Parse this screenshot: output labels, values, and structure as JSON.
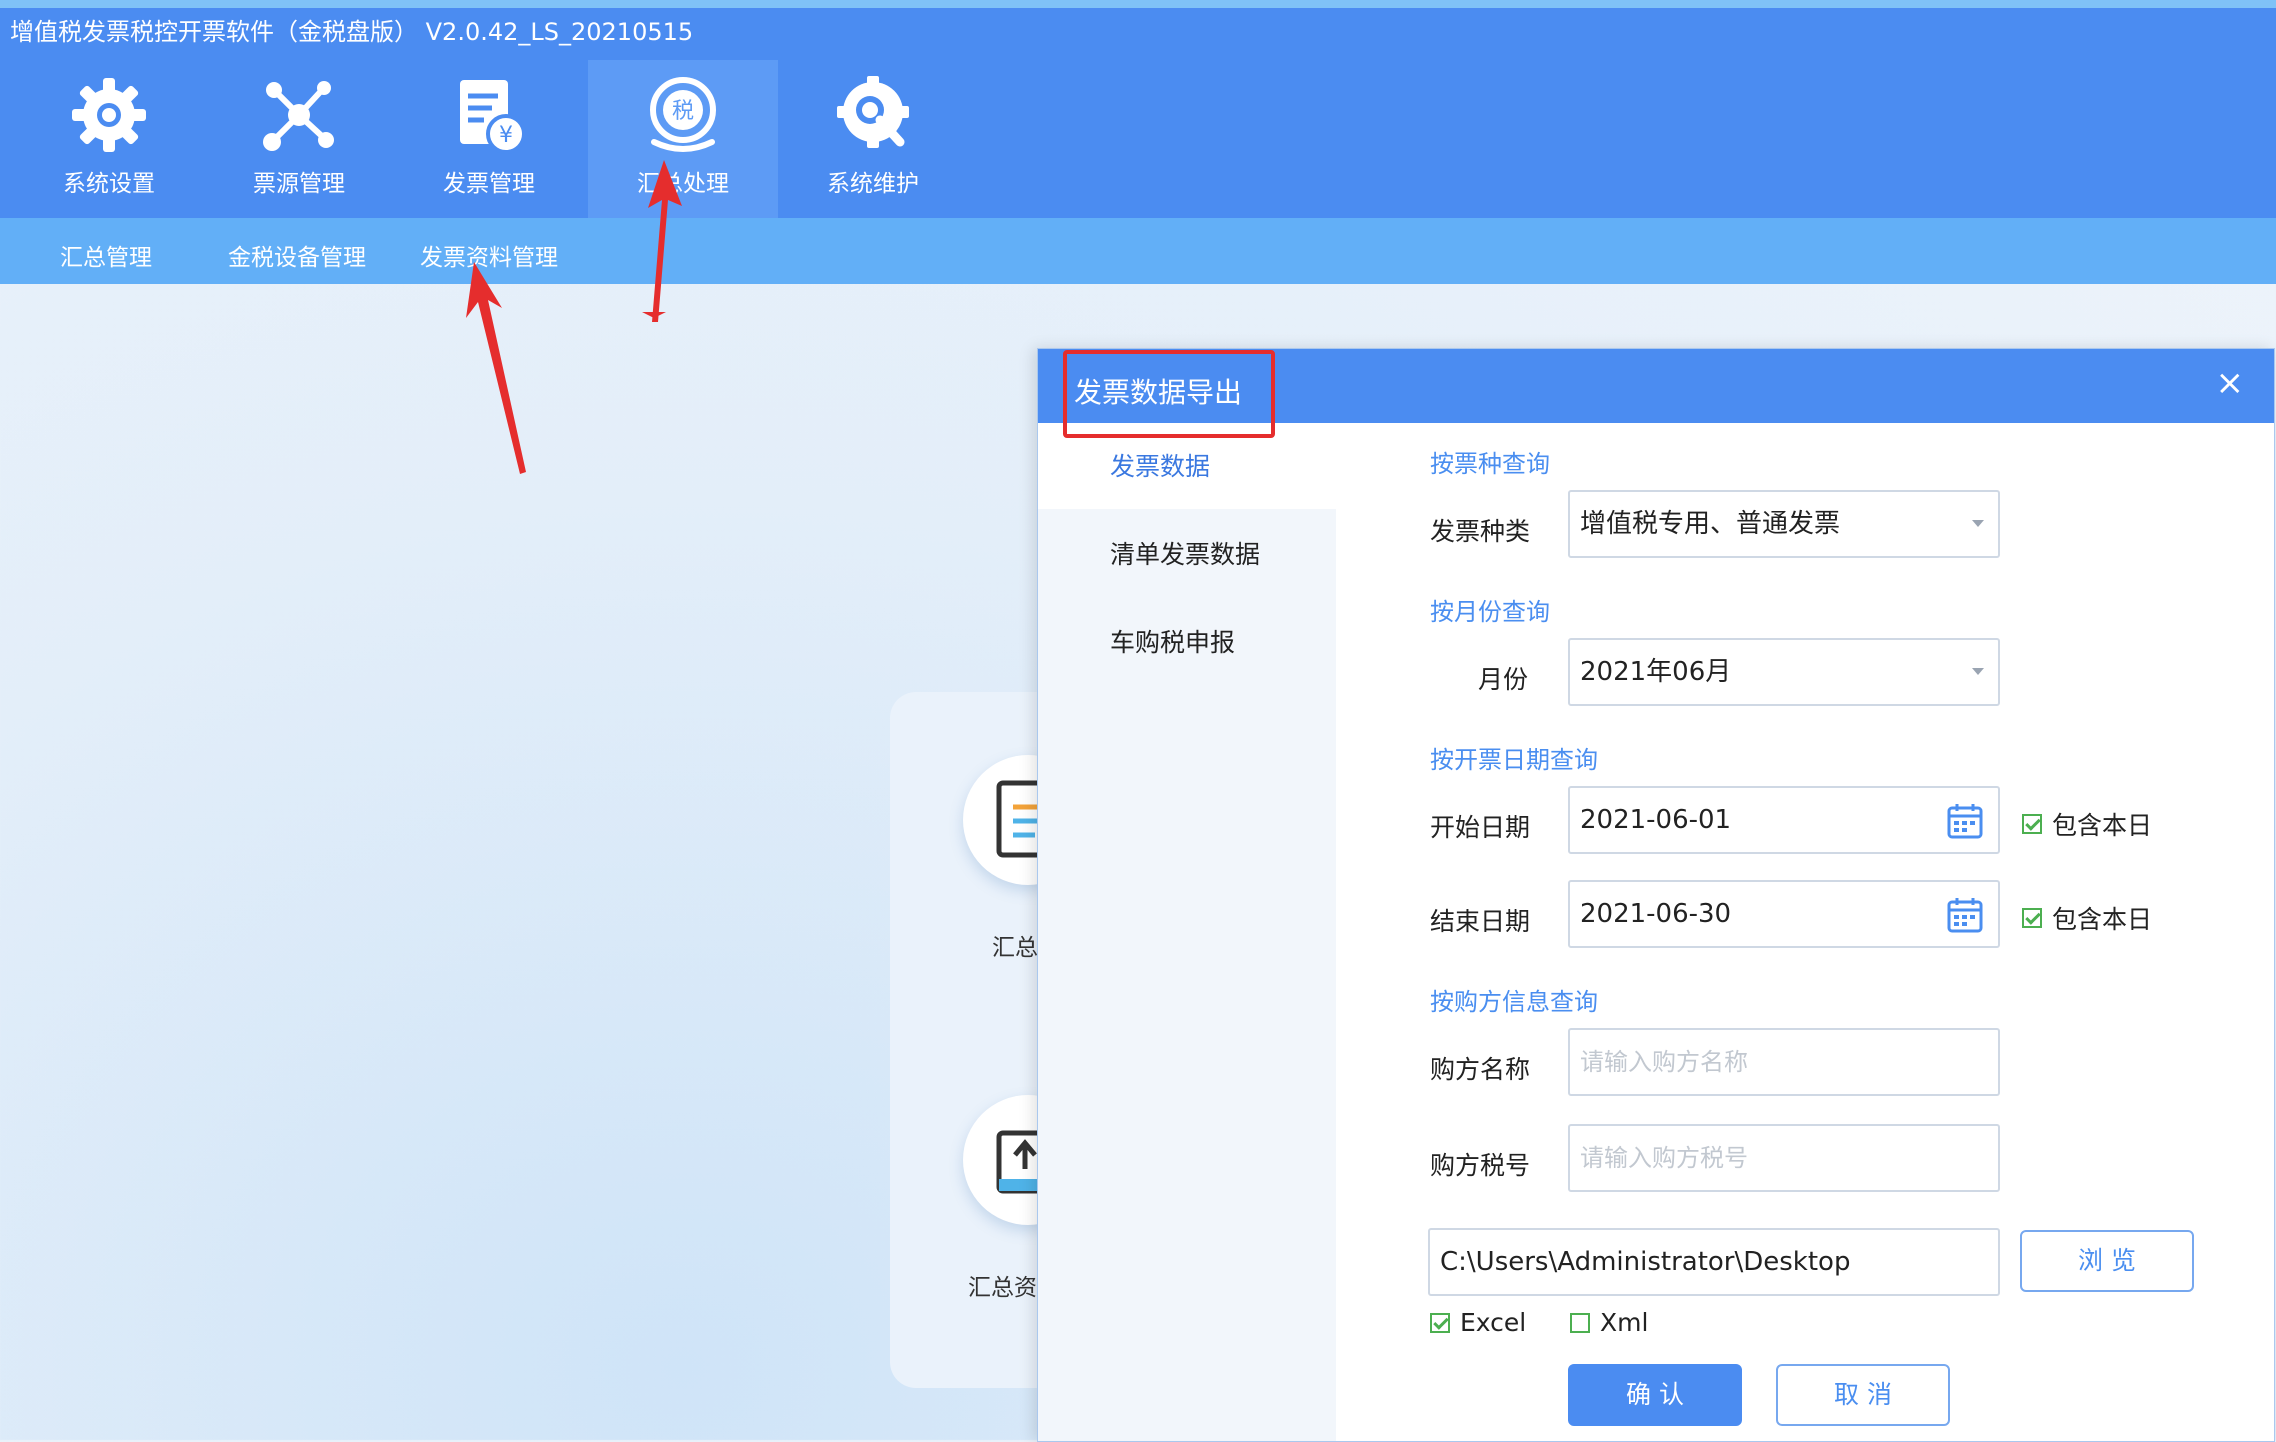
{
  "app": {
    "title": "增值税发票税控开票软件（金税盘版） V2.0.42_LS_20210515"
  },
  "toolbar": {
    "items": [
      {
        "label": "系统设置",
        "icon": "gear-icon"
      },
      {
        "label": "票源管理",
        "icon": "network-icon"
      },
      {
        "label": "发票管理",
        "icon": "invoice-icon"
      },
      {
        "label": "汇总处理",
        "icon": "tax-stamp-icon"
      },
      {
        "label": "系统维护",
        "icon": "wrench-icon"
      }
    ],
    "active_index": 3
  },
  "subnav": {
    "items": [
      "汇总管理",
      "金税设备管理",
      "发票资料管理"
    ]
  },
  "background": {
    "label1": "汇总",
    "label2": "汇总资"
  },
  "dialog": {
    "title": "发票数据导出",
    "close": "×",
    "nav": [
      "发票数据",
      "清单发票数据",
      "车购税申报"
    ],
    "nav_active": 0,
    "section_type": "按票种查询",
    "invoice_type_label": "发票种类",
    "invoice_type_value": "增值税专用、普通发票",
    "section_month": "按月份查询",
    "month_label": "月份",
    "month_value": "2021年06月",
    "section_date": "按开票日期查询",
    "start_label": "开始日期",
    "start_value": "2021-06-01",
    "end_label": "结束日期",
    "end_value": "2021-06-30",
    "include_today": "包含本日",
    "include_today_start_checked": true,
    "include_today_end_checked": true,
    "section_buyer": "按购方信息查询",
    "buyer_name_label": "购方名称",
    "buyer_name_placeholder": "请输入购方名称",
    "buyer_tax_label": "购方税号",
    "buyer_tax_placeholder": "请输入购方税号",
    "path_value": "C:\\Users\\Administrator\\Desktop",
    "browse": "浏 览",
    "format_excel": "Excel",
    "format_excel_checked": true,
    "format_xml": "Xml",
    "format_xml_checked": false,
    "confirm": "确 认",
    "cancel": "取 消"
  },
  "colors": {
    "toolbar": "#4b8cf1",
    "subbar": "#62aff7",
    "accent": "#4a8ef0",
    "annotation": "#e52d2d"
  }
}
